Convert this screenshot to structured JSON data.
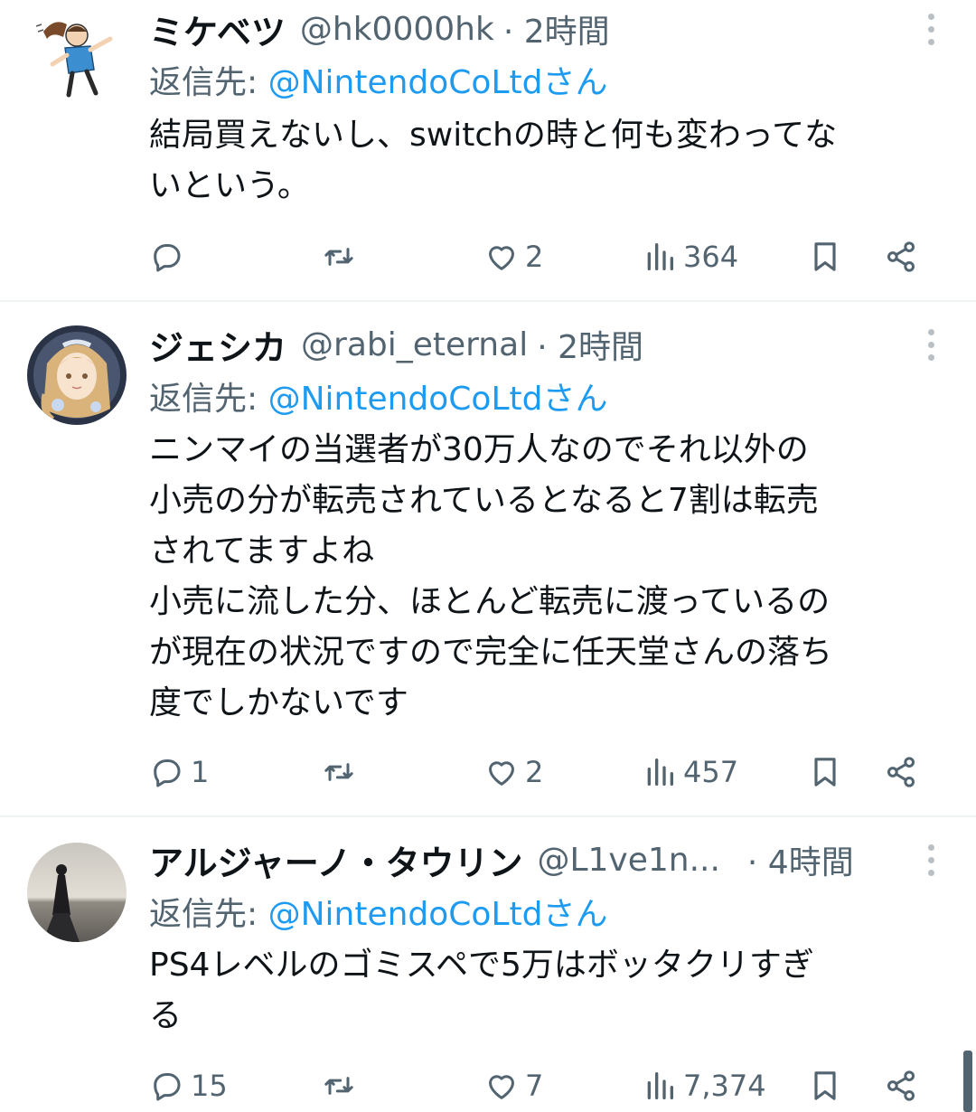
{
  "colors": {
    "text": "#0f1419",
    "secondary": "#536471",
    "link": "#1d9bf0",
    "divider": "#eff3f4"
  },
  "tweets": [
    {
      "display_name": "ミケベツ",
      "handle": "@hk0000hk",
      "time": "· 2時間",
      "reply_prefix": "返信先: ",
      "reply_mention": "@NintendoCoLtdさん",
      "text": "結局買えないし、switchの時と何も変わってな\nいという。",
      "replies": "",
      "retweets": "",
      "likes": "2",
      "views": "364"
    },
    {
      "display_name": "ジェシカ",
      "handle": "@rabi_eternal",
      "time": "· 2時間",
      "reply_prefix": "返信先: ",
      "reply_mention": "@NintendoCoLtdさん",
      "text": "ニンマイの当選者が30万人なのでそれ以外の\n小売の分が転売されているとなると7割は転売\nされてますよね\n小売に流した分、ほとんど転売に渡っているの\nが現在の状況ですので完全に任天堂さんの落ち\n度でしかないです",
      "replies": "1",
      "retweets": "",
      "likes": "2",
      "views": "457"
    },
    {
      "display_name": "アルジャーノ・タウリン",
      "handle": "@L1ve1n...",
      "time": "· 4時間",
      "reply_prefix": "返信先: ",
      "reply_mention": "@NintendoCoLtdさん",
      "text": "PS4レベルのゴミスペで5万はボッタクリすぎ\nる",
      "replies": "15",
      "retweets": "",
      "likes": "7",
      "views": "7,374"
    }
  ],
  "icons": {
    "reply": "speech-bubble-icon",
    "retweet": "retweet-arrows-icon",
    "like": "heart-icon",
    "views": "bar-chart-icon",
    "bookmark": "bookmark-icon",
    "share": "share-icon",
    "more": "vertical-dots-icon"
  }
}
